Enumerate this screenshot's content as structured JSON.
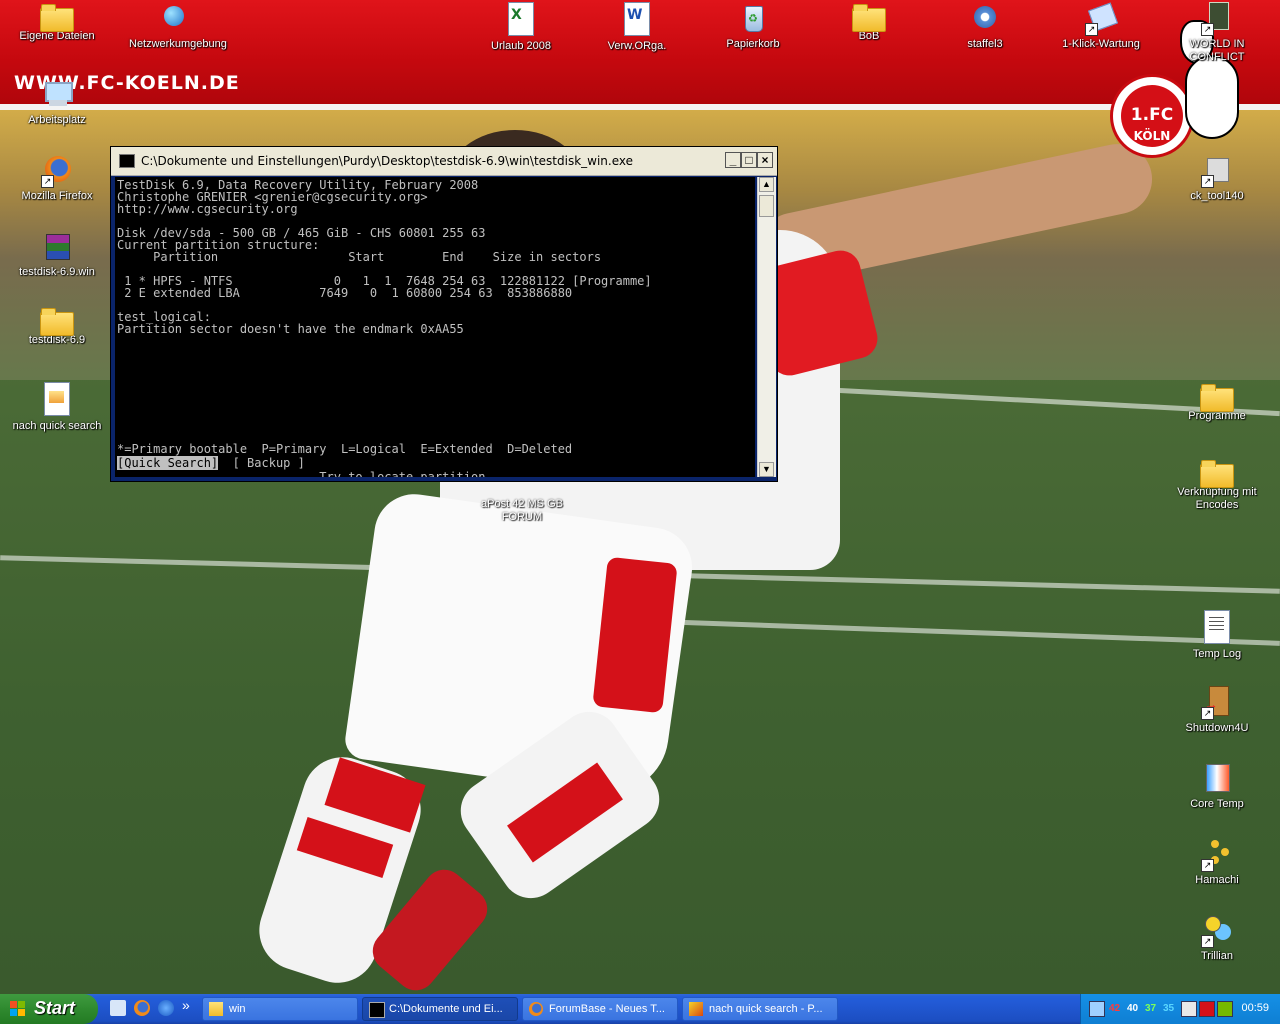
{
  "banner": {
    "website": "WWW.FC-KOELN.DE",
    "crest_text": "1.FC KÖLN"
  },
  "desktop_icons": [
    {
      "label": "Eigene Dateien",
      "icon": "my-documents-icon"
    },
    {
      "label": "Netzwerkumgebung",
      "icon": "network-icon"
    },
    {
      "label": "Urlaub 2008",
      "icon": "excel-file-icon"
    },
    {
      "label": "Verw.ORga.",
      "icon": "word-file-icon"
    },
    {
      "label": "Papierkorb",
      "icon": "recycle-bin-icon"
    },
    {
      "label": "BoB",
      "icon": "folder-icon"
    },
    {
      "label": "staffel3",
      "icon": "media-player-icon"
    },
    {
      "label": "1-Klick-Wartung",
      "icon": "maintenance-shortcut-icon"
    },
    {
      "label": "WORLD IN CONFLICT",
      "icon": "game-shortcut-icon"
    },
    {
      "label": "Arbeitsplatz",
      "icon": "my-computer-icon"
    },
    {
      "label": "Mozilla Firefox",
      "icon": "firefox-icon"
    },
    {
      "label": "testdisk-6.9.win",
      "icon": "winrar-archive-icon"
    },
    {
      "label": "testdisk-6.9",
      "icon": "folder-icon"
    },
    {
      "label": "nach quick search",
      "icon": "image-file-icon"
    },
    {
      "label": "ck_tool140",
      "icon": "tool-shortcut-icon"
    },
    {
      "label": "Programme",
      "icon": "folder-icon"
    },
    {
      "label": "Verknüpfung mit Encodes",
      "icon": "folder-shortcut-icon"
    },
    {
      "label": "Temp Log",
      "icon": "text-file-icon"
    },
    {
      "label": "Shutdown4U",
      "icon": "shutdown-shortcut-icon"
    },
    {
      "label": "Core Temp",
      "icon": "thermometer-icon"
    },
    {
      "label": "Hamachi",
      "icon": "hamachi-icon"
    },
    {
      "label": "Trillian",
      "icon": "trillian-icon"
    },
    {
      "label": "aPost 42 MS GB FORUM",
      "icon": "partially-hidden-icon"
    }
  ],
  "console": {
    "title": "C:\\Dokumente und Einstellungen\\Purdy\\Desktop\\testdisk-6.9\\win\\testdisk_win.exe",
    "lines": [
      "TestDisk 6.9, Data Recovery Utility, February 2008",
      "Christophe GRENIER <grenier@cgsecurity.org>",
      "http://www.cgsecurity.org",
      "",
      "Disk /dev/sda - 500 GB / 465 GiB - CHS 60801 255 63",
      "Current partition structure:",
      "     Partition                  Start        End    Size in sectors",
      "",
      " 1 * HPFS - NTFS              0   1  1  7648 254 63  122881122 [Programme]",
      " 2 E extended LBA           7649   0  1 60800 254 63  853886880",
      "",
      "test_logical:",
      "Partition sector doesn't have the endmark 0xAA55",
      "",
      "",
      "",
      "",
      "",
      "",
      "",
      "",
      "",
      "*=Primary bootable  P=Primary  L=Logical  E=Extended  D=Deleted"
    ],
    "menu_selected": "[Quick Search]",
    "menu_other": "  [ Backup ]",
    "hint": "                            Try to locate partition"
  },
  "taskbar": {
    "start_label": "Start",
    "quicklaunch_more": "»",
    "buttons": [
      {
        "label": "win",
        "icon": "folder-icon",
        "active": false
      },
      {
        "label": "C:\\Dokumente und Ei...",
        "icon": "console-icon",
        "active": true
      },
      {
        "label": "ForumBase - Neues T...",
        "icon": "firefox-icon",
        "active": false
      },
      {
        "label": "nach quick search - P...",
        "icon": "paint-icon",
        "active": false
      }
    ],
    "temps": [
      "42",
      "40",
      "37",
      "35"
    ],
    "clock": "00:59"
  },
  "colors": {
    "banner_red": "#d40f16",
    "taskbar_blue": "#245edb",
    "start_green": "#2f8a2f",
    "temp_colors": [
      "#ff3b3b",
      "#ffffff",
      "#7cff5a",
      "#5ad7ff"
    ]
  }
}
